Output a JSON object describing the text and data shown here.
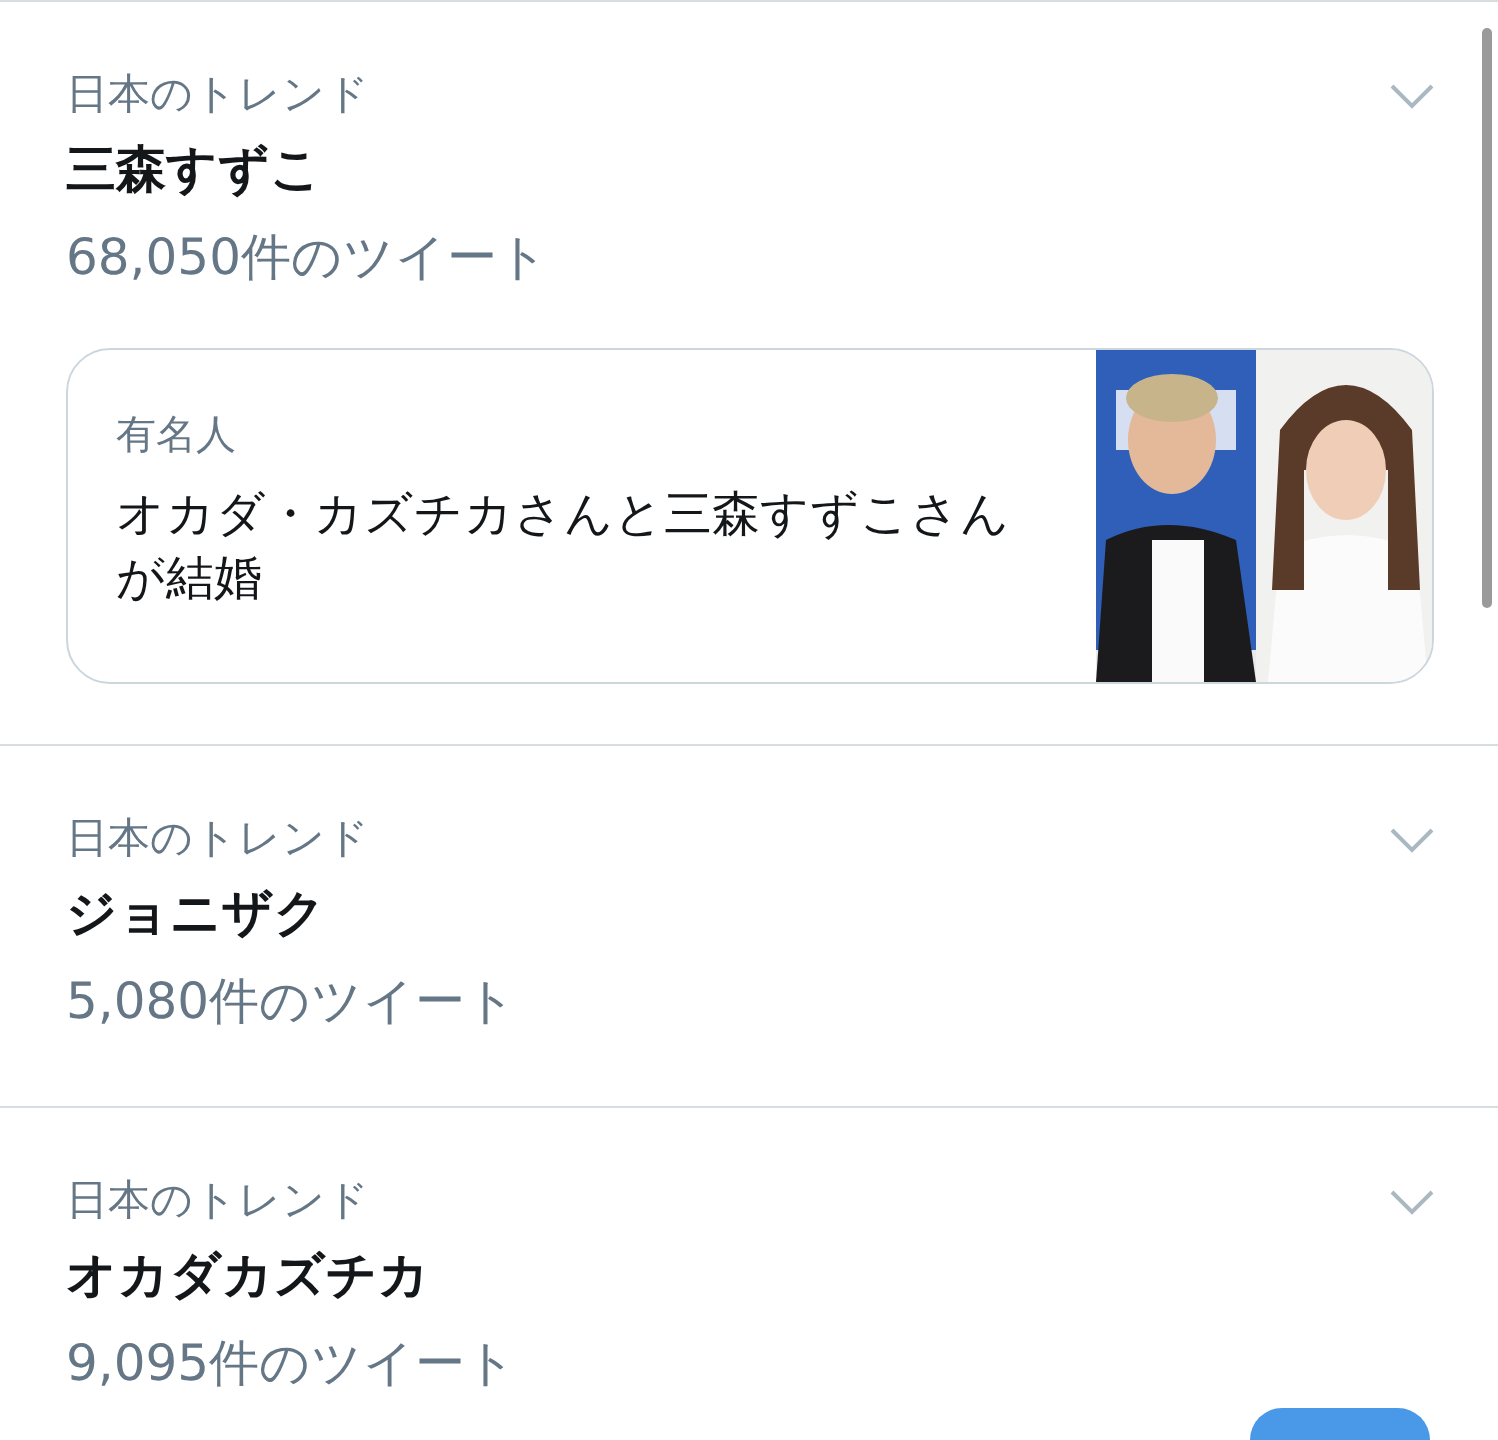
{
  "trends": [
    {
      "context": "日本のトレンド",
      "title": "三森すずこ",
      "count": "68,050件のツイート",
      "card": {
        "category": "有名人",
        "headline": "オカダ・カズチカさんと三森すずこさんが結婚"
      }
    },
    {
      "context": "日本のトレンド",
      "title": "ジョニザク",
      "count": "5,080件のツイート"
    },
    {
      "context": "日本のトレンド",
      "title": "オカダカズチカ",
      "count": "9,095件のツイート"
    }
  ]
}
